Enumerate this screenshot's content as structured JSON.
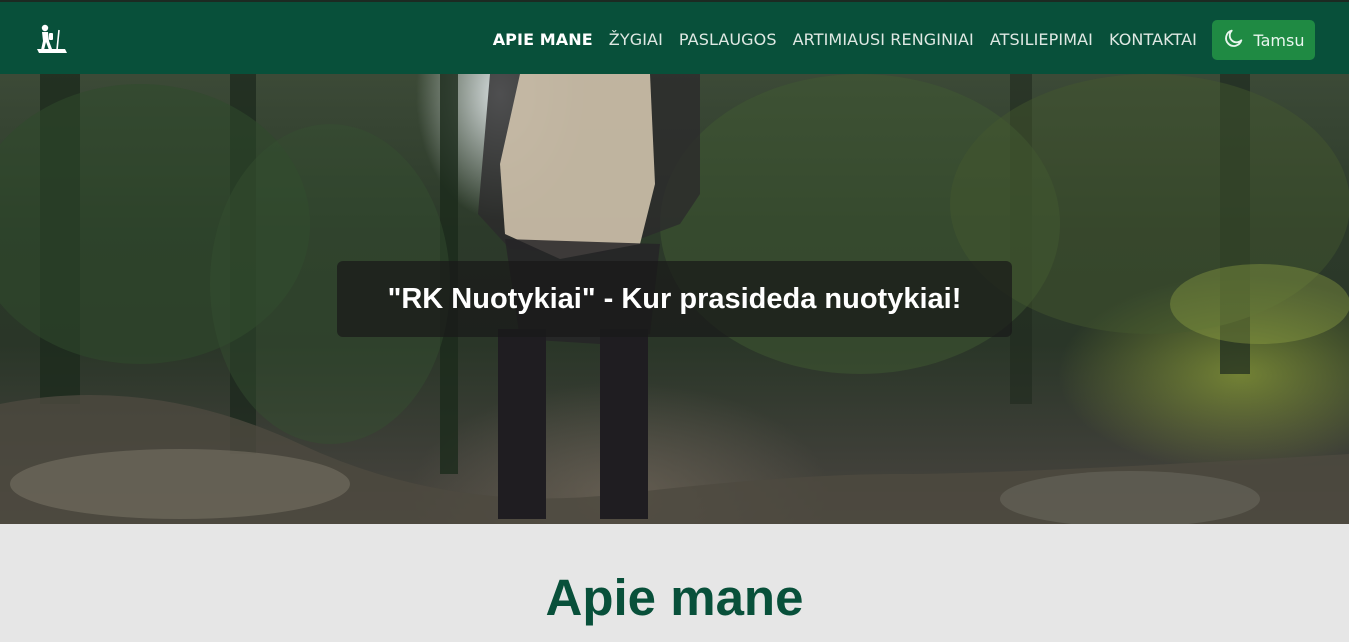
{
  "navbar": {
    "logo_icon": "hiker-icon",
    "links": [
      {
        "label": "APIE MANE",
        "active": true
      },
      {
        "label": "ŽYGIAI",
        "active": false
      },
      {
        "label": "PASLAUGOS",
        "active": false
      },
      {
        "label": "ARTIMIAUSI RENGINIAI",
        "active": false
      },
      {
        "label": "ATSILIEPIMAI",
        "active": false
      },
      {
        "label": "KONTAKTAI",
        "active": false
      }
    ],
    "theme_toggle": {
      "label": "Tamsu",
      "icon": "moon-icon"
    }
  },
  "hero": {
    "caption": "\"RK Nuotykiai\" - Kur prasideda nuotykiai!"
  },
  "about": {
    "title": "Apie mane"
  },
  "colors": {
    "nav_bg": "#08503a",
    "accent_button": "#1f8a43",
    "heading": "#08503a",
    "section_bg": "#e6e6e6"
  }
}
